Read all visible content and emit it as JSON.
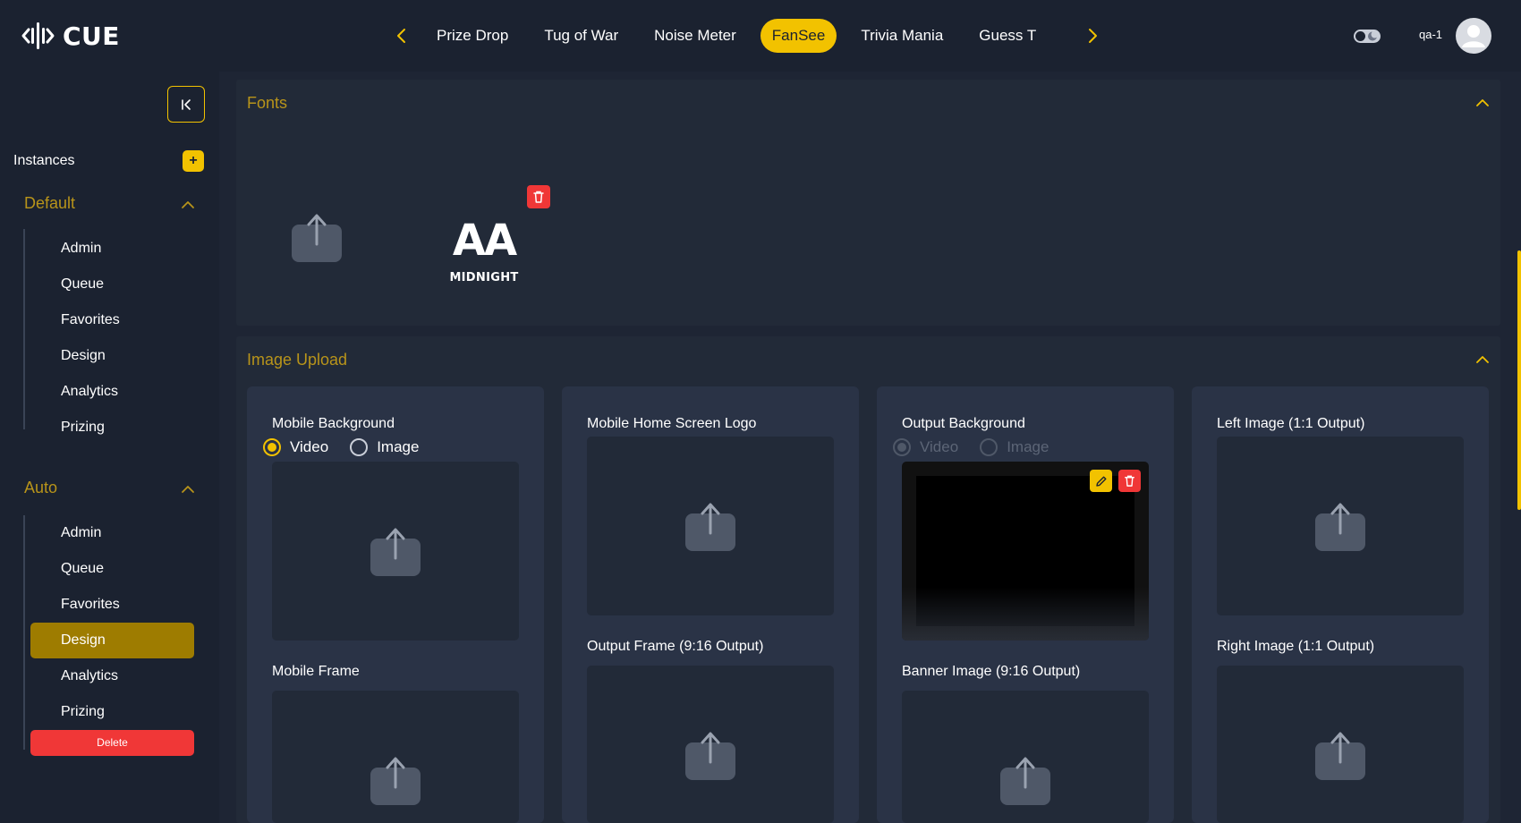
{
  "app": {
    "logo_text": "CUE",
    "logo_icon": "cue-logo-icon",
    "accent": "#f2c200",
    "danger": "#f03737",
    "user": "qa-1"
  },
  "nav": {
    "tabs": [
      {
        "label": "Prize Drop"
      },
      {
        "label": "Tug of War"
      },
      {
        "label": "Noise Meter"
      },
      {
        "label": "FanSee",
        "active": true
      },
      {
        "label": "Trivia Mania"
      },
      {
        "label": "Guess T"
      }
    ],
    "prev_icon": "chevron-left-icon",
    "next_icon": "chevron-right-icon"
  },
  "sidebar": {
    "instances_label": "Instances",
    "add_label": "+",
    "groups": [
      {
        "title": "Default",
        "items": [
          "Admin",
          "Queue",
          "Favorites",
          "Design",
          "Analytics",
          "Prizing"
        ]
      },
      {
        "title": "Auto",
        "items": [
          "Admin",
          "Queue",
          "Favorites",
          "Design",
          "Analytics",
          "Prizing"
        ],
        "active_item": "Design"
      }
    ],
    "delete_label": "Delete"
  },
  "fonts_panel": {
    "title": "Fonts",
    "font": {
      "sample": "AA",
      "name": "MIDNIGHT"
    }
  },
  "image_panel": {
    "title": "Image Upload",
    "cards": [
      {
        "label": "Mobile Background",
        "radio": {
          "options": [
            "Video",
            "Image"
          ],
          "selected": "Video",
          "disabled": false
        },
        "second_label": "Mobile Frame"
      },
      {
        "label": "Mobile Home Screen Logo",
        "second_label": "Output Frame (9:16 Output)"
      },
      {
        "label": "Output Background",
        "radio": {
          "options": [
            "Video",
            "Image"
          ],
          "selected": "Video",
          "disabled": true
        },
        "has_preview": true,
        "second_label": "Banner Image (9:16 Output)"
      },
      {
        "label": "Left Image (1:1 Output)",
        "second_label": "Right Image (1:1 Output)"
      }
    ]
  }
}
